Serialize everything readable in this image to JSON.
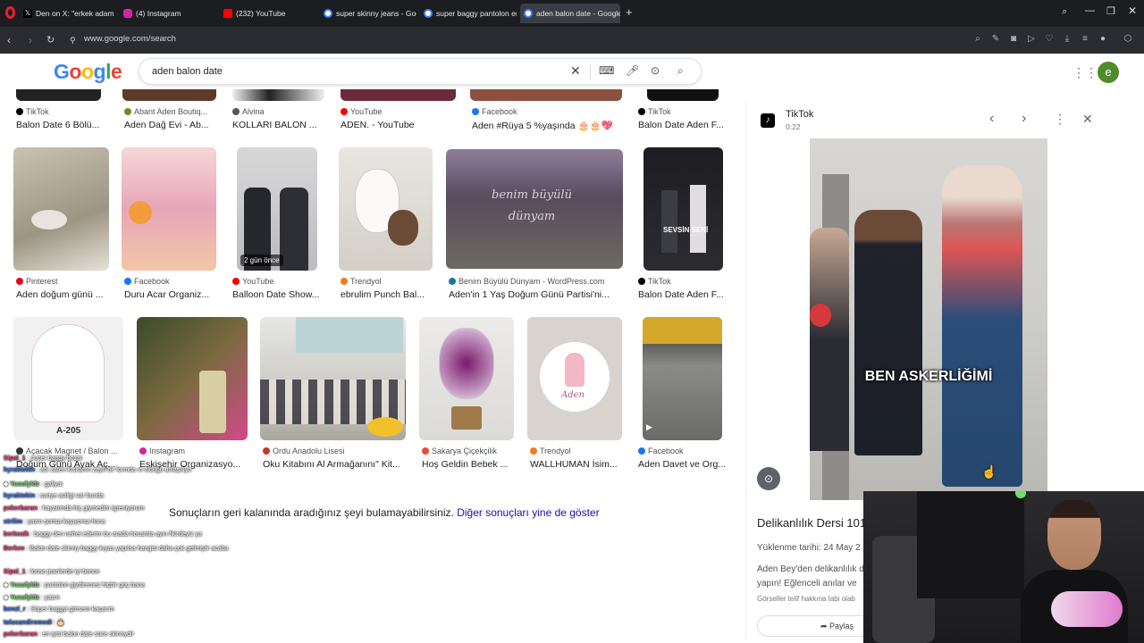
{
  "browser": {
    "tabs": [
      {
        "label": "Den on X: \"erkek adam de",
        "color": "#000000"
      },
      {
        "label": "(4) Instagram",
        "color": "#d6249f"
      },
      {
        "label": "(232) YouTube",
        "color": "#ff0000"
      },
      {
        "label": "super skinny jeans - Goog",
        "color": "#4285f4"
      },
      {
        "label": "super baggy pantolon erk",
        "color": "#4285f4"
      },
      {
        "label": "aden balon date - Google",
        "color": "#4285f4"
      }
    ],
    "url": "www.google.com/search"
  },
  "google": {
    "logo": "Google",
    "query": "aden balon date",
    "account_initial": "e"
  },
  "results_row0": [
    {
      "source": "TikTok",
      "title": "Balon Date 6 Bölü..."
    },
    {
      "source": "Abant Aden Boutiq...",
      "title": "Aden Dağ Evi - Ab..."
    },
    {
      "source": "Alvina",
      "title": "KOLLARI BALON ..."
    },
    {
      "source": "YouTube",
      "title": "ADEN. - YouTube"
    },
    {
      "source": "Facebook",
      "title": "Aden #Rüya 5 %yaşında 🎂🎂💖"
    },
    {
      "source": "TikTok",
      "title": "Balon Date Aden F..."
    }
  ],
  "results_row1": [
    {
      "source": "Pinterest",
      "title": "Aden doğum günü ..."
    },
    {
      "source": "Facebook",
      "title": "Duru Acar Organiz..."
    },
    {
      "source": "YouTube",
      "title": "Balloon Date Show...",
      "badge": "2 gün önce"
    },
    {
      "source": "Trendyol",
      "title": "ebrulim Punch Bal..."
    },
    {
      "source": "Benim Büyülü Dünyam - WordPress.com",
      "title": "Aden'in 1 Yaş Doğum Günü Partisi'ni..."
    },
    {
      "source": "TikTok",
      "title": "Balon Date Aden F..."
    }
  ],
  "results_row2": [
    {
      "source": "Açacak Magnet / Balon ...",
      "title": "Doğum Günü Ayak Aç..."
    },
    {
      "source": "Instagram",
      "title": "Eskişehir Organizasyo..."
    },
    {
      "source": "Ordu Anadolu Lisesi",
      "title": "Oku Kitabını Al Armağanını\" Kit..."
    },
    {
      "source": "Sakarya Çiçekçilik",
      "title": "Hoş Geldin Bebek ..."
    },
    {
      "source": "Trendyol",
      "title": "WALLHUMAN İsim..."
    },
    {
      "source": "Facebook",
      "title": "Aden Davet ve Org..."
    }
  ],
  "thumb_texts": {
    "benim": "benim büyülü dünyam",
    "sevsin": "SEVSİN SENİ",
    "a205": "A-205",
    "aden_script": "Aden"
  },
  "more_results": {
    "text": "Sonuçların geri kalanında aradığınız şeyi bulamayabilirsiniz.",
    "link": "Diğer sonuçları yine de göster"
  },
  "panel": {
    "source": "TikTok",
    "duration": "0:22",
    "video_caption": "BEN ASKERLİĞİMİ",
    "title": "Delikanlılık Dersi 101:",
    "upload_label": "Yüklenme tarihi:",
    "upload_date": "24 May 2",
    "description": "Aden Bey'den delikanlılık d",
    "description2": "yapın! Eğlenceli anılar ve",
    "rights": "Görseller telif hakkına tabi olab",
    "share": "Paylaş"
  },
  "chat": [
    {
      "user": "Sipal_1",
      "text": "super baggy bozar",
      "c": "u3"
    },
    {
      "user": "hyraktekin",
      "text": "adı zaten kıskanın zayıf bir formda ın olduğu anlaşılıyo",
      "c": "u2"
    },
    {
      "user": "Yusufyldz",
      "text": "galiyar",
      "c": "u"
    },
    {
      "user": "hyraktekin",
      "text": "suriye aciligi var bunda",
      "c": "u2"
    },
    {
      "user": "pekerbaran",
      "text": "hayatımda hiç giymedim igreniyorum",
      "c": "u3"
    },
    {
      "user": "strilim",
      "text": "yazın şortsa kayıyorsa hoca",
      "c": "u2"
    },
    {
      "user": "berkealk",
      "text": "baggy den nefret ederim bu arada hocamla aynı fikirdeyiz ya",
      "c": "u3"
    },
    {
      "user": "Berkee",
      "text": "Balon date skinny baggy kıyas yapılsa hangisi daha çok gelmiştir acaba",
      "c": "u3"
    },
    {
      "user": "Sipal_1",
      "text": "loose jeanlerde iyi bence",
      "c": "u3"
    },
    {
      "user": "Yusufyldz",
      "text": "pantolon giydiremez hiçbir güç bana",
      "c": "u"
    },
    {
      "user": "Yusufyldz",
      "text": "yazın",
      "c": "u"
    },
    {
      "user": "benzl_r",
      "text": "Süper baggyi görsem kaçarım",
      "c": "u2"
    },
    {
      "user": "tolucandiremedi",
      "text": "🎂",
      "c": "u2"
    },
    {
      "user": "pekerbaran",
      "text": "en iyisi balon date süce skinnydir",
      "c": "u3"
    }
  ],
  "colors": {
    "google_blue": "#4285f4",
    "google_red": "#ea4335",
    "google_yellow": "#fbbc05",
    "google_green": "#34a853",
    "link": "#1a0dab"
  }
}
